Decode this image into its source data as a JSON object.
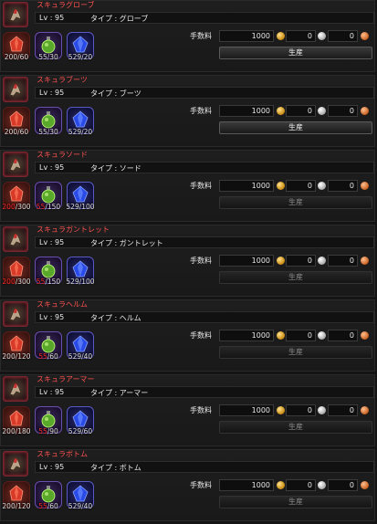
{
  "labels": {
    "level_prefix": "Lv : ",
    "type_prefix": "タイプ : ",
    "fee_label": "手数料",
    "craft_button": "生産"
  },
  "recipes": [
    {
      "name": "スキュラグローブ",
      "level": "95",
      "type": "グローブ",
      "fee": {
        "gold": "1000",
        "silver": "0",
        "copper": "0"
      },
      "materials": [
        {
          "owned": "200",
          "need": "60",
          "short": false
        },
        {
          "owned": "55",
          "need": "30",
          "short": false
        },
        {
          "owned": "529",
          "need": "20",
          "short": false
        }
      ],
      "craft_enabled": true
    },
    {
      "name": "スキュラブーツ",
      "level": "95",
      "type": "ブーツ",
      "fee": {
        "gold": "1000",
        "silver": "0",
        "copper": "0"
      },
      "materials": [
        {
          "owned": "200",
          "need": "60",
          "short": false
        },
        {
          "owned": "55",
          "need": "30",
          "short": false
        },
        {
          "owned": "529",
          "need": "20",
          "short": false
        }
      ],
      "craft_enabled": true
    },
    {
      "name": "スキュラソード",
      "level": "95",
      "type": "ソード",
      "fee": {
        "gold": "1000",
        "silver": "0",
        "copper": "0"
      },
      "materials": [
        {
          "owned": "200",
          "need": "300",
          "short": true
        },
        {
          "owned": "55",
          "need": "150",
          "short": true
        },
        {
          "owned": "529",
          "need": "100",
          "short": false
        }
      ],
      "craft_enabled": false
    },
    {
      "name": "スキュラガントレット",
      "level": "95",
      "type": "ガントレット",
      "fee": {
        "gold": "1000",
        "silver": "0",
        "copper": "0"
      },
      "materials": [
        {
          "owned": "200",
          "need": "300",
          "short": true
        },
        {
          "owned": "55",
          "need": "150",
          "short": true
        },
        {
          "owned": "529",
          "need": "100",
          "short": false
        }
      ],
      "craft_enabled": false
    },
    {
      "name": "スキュラヘルム",
      "level": "95",
      "type": "ヘルム",
      "fee": {
        "gold": "1000",
        "silver": "0",
        "copper": "0"
      },
      "materials": [
        {
          "owned": "200",
          "need": "120",
          "short": false
        },
        {
          "owned": "55",
          "need": "60",
          "short": true
        },
        {
          "owned": "529",
          "need": "40",
          "short": false
        }
      ],
      "craft_enabled": false
    },
    {
      "name": "スキュラアーマー",
      "level": "95",
      "type": "アーマー",
      "fee": {
        "gold": "1000",
        "silver": "0",
        "copper": "0"
      },
      "materials": [
        {
          "owned": "200",
          "need": "180",
          "short": false
        },
        {
          "owned": "55",
          "need": "90",
          "short": true
        },
        {
          "owned": "529",
          "need": "60",
          "short": false
        }
      ],
      "craft_enabled": false
    },
    {
      "name": "スキュラボトム",
      "level": "95",
      "type": "ボトム",
      "fee": {
        "gold": "1000",
        "silver": "0",
        "copper": "0"
      },
      "materials": [
        {
          "owned": "200",
          "need": "120",
          "short": false
        },
        {
          "owned": "55",
          "need": "60",
          "short": true
        },
        {
          "owned": "529",
          "need": "40",
          "short": false
        }
      ],
      "craft_enabled": false
    }
  ],
  "icons": {
    "equipment": [
      "glove-icon",
      "boots-icon",
      "sword-icon",
      "gauntlet-icon",
      "helm-icon",
      "armor-icon",
      "bottom-icon"
    ],
    "materials": [
      "red-crystal-icon",
      "green-potion-icon",
      "blue-gem-icon"
    ],
    "currency": [
      "gold-coin-icon",
      "silver-coin-icon",
      "copper-coin-icon"
    ]
  },
  "colors": {
    "item_name": "#ff5050",
    "short_material": "#ff3030",
    "gold": "#c98a10",
    "silver": "#a8a8a8",
    "copper": "#c86020"
  }
}
